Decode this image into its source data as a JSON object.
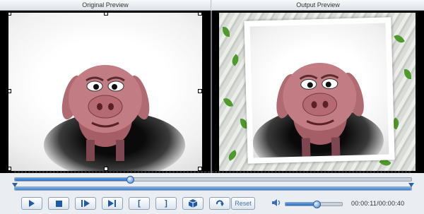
{
  "headers": {
    "original": "Original Preview",
    "output": "Output Preview"
  },
  "playback": {
    "progress": 0.29,
    "trim_start": 0.0,
    "trim_end": 1.0,
    "volume": 0.55,
    "current_time": "00:00:11",
    "total_time": "00:00:40",
    "time_display": "00:00:11/00:00:40"
  },
  "controls": [
    {
      "name": "play-button",
      "icon": "play-icon"
    },
    {
      "name": "stop-button",
      "icon": "stop-icon"
    },
    {
      "name": "next-frame-button",
      "icon": "step-forward-icon"
    },
    {
      "name": "skip-end-button",
      "icon": "skip-to-end-icon"
    },
    {
      "name": "set-start-button",
      "label": "["
    },
    {
      "name": "set-end-button",
      "label": "]"
    },
    {
      "name": "snapshot-button",
      "icon": "cube-icon"
    },
    {
      "name": "rotate-button",
      "icon": "rotate-icon"
    }
  ],
  "reset_label": "Reset",
  "colors": {
    "accent": "#2f6fc0",
    "header_bg": "#dfe3e8",
    "preview_bg": "#000000"
  }
}
